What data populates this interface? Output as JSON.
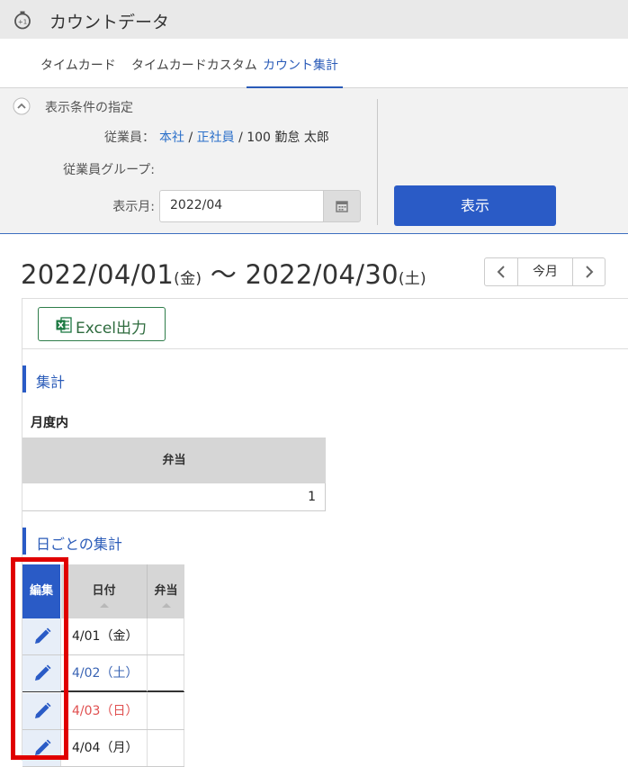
{
  "app": {
    "title": "カウントデータ"
  },
  "tabs": [
    {
      "label": "タイムカード",
      "active": false
    },
    {
      "label": "タイムカードカスタム",
      "active": false
    },
    {
      "label": "カウント集計",
      "active": true
    }
  ],
  "filter": {
    "title": "表示条件の指定",
    "employee_label": "従業員：",
    "employee_company": "本社",
    "employee_sep1": " / ",
    "employee_type": "正社員",
    "employee_rest": " / 100 勤怠 太郎",
    "group_label": "従業員グループ:",
    "month_label": "表示月:",
    "month_value": "2022/04",
    "show_button": "表示"
  },
  "period": {
    "start": "2022/04/01",
    "start_day": "(金)",
    "tilde": " 〜 ",
    "end": "2022/04/30",
    "end_day": "(土)"
  },
  "pager": {
    "current_label": "今月"
  },
  "panel": {
    "excel_button": "Excel出力",
    "summary_title": "集計",
    "monthly_label": "月度内",
    "summary_header": "弁当",
    "summary_value": "1",
    "daily_title": "日ごとの集計",
    "daily_headers": {
      "edit": "編集",
      "date": "日付",
      "bento": "弁当"
    },
    "daily_rows": [
      {
        "date": "4/01（金）",
        "color": "#222222",
        "bento": ""
      },
      {
        "date": "4/02（土）",
        "color": "#3a64b4",
        "bento": ""
      },
      {
        "date": "4/03（日）",
        "color": "#e05050",
        "bento": ""
      },
      {
        "date": "4/04（月）",
        "color": "#222222",
        "bento": ""
      }
    ]
  },
  "colors": {
    "accent": "#2a5bc6",
    "highlight": "#e00000",
    "excel_green": "#2e7d4a"
  }
}
